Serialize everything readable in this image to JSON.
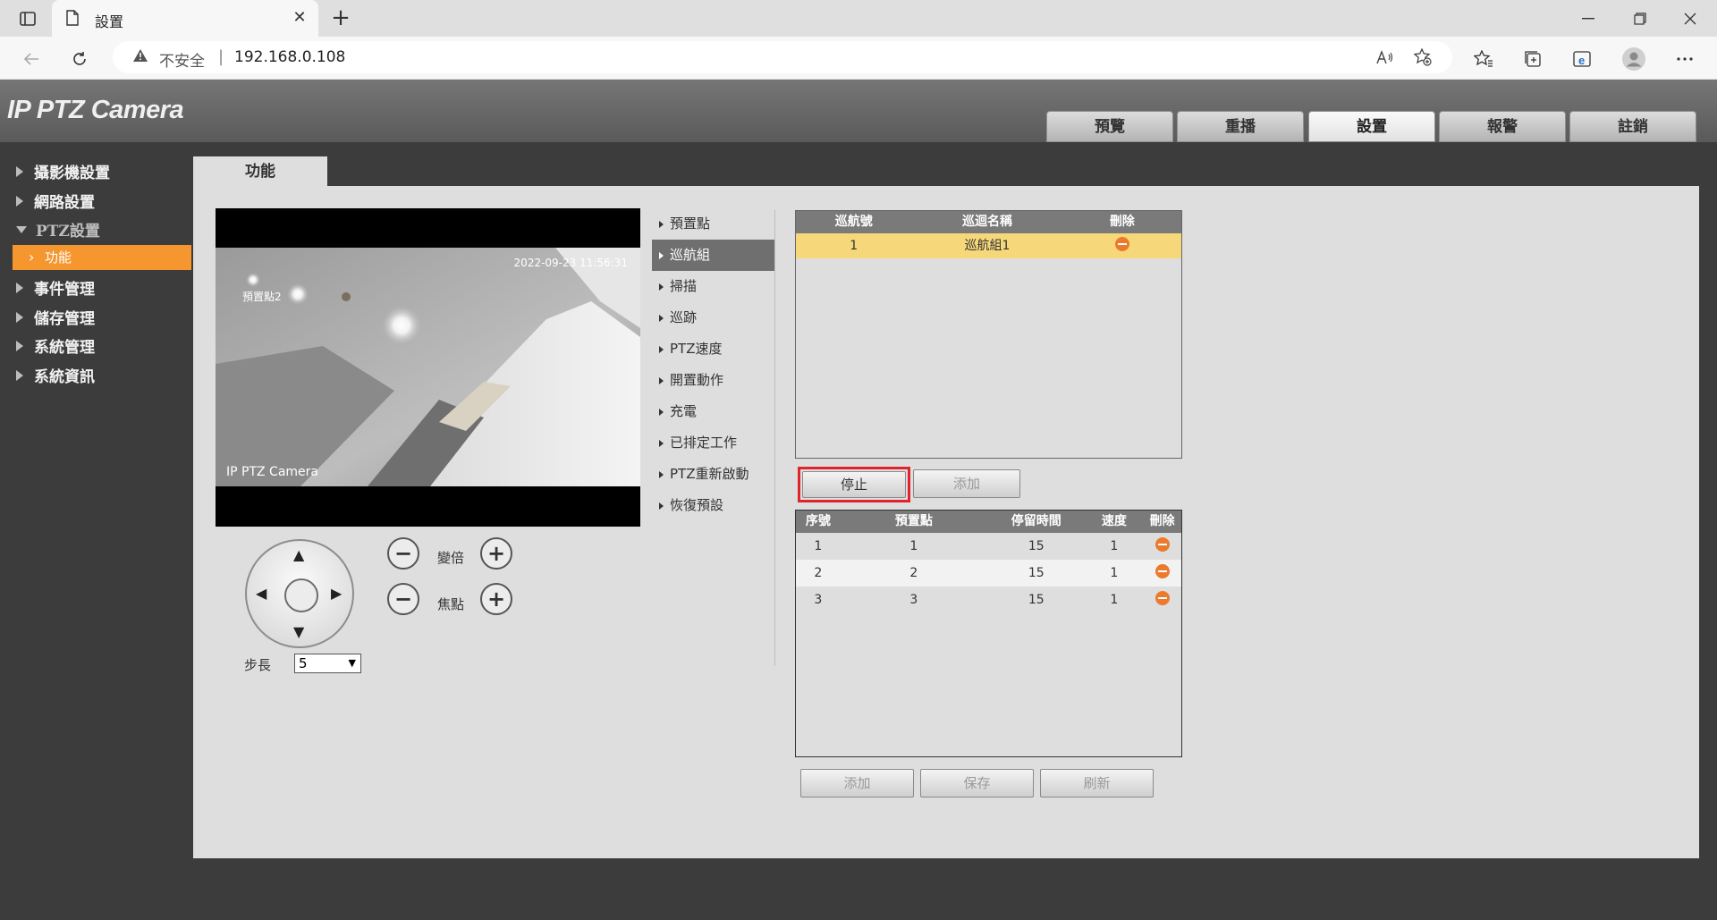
{
  "browser": {
    "tab_title": "設置",
    "tab_close": "✕",
    "new_tab": "+",
    "insecure_label": "不安全",
    "separator": "|",
    "url": "192.168.0.108"
  },
  "app": {
    "logo": "IP PTZ Camera",
    "main_tabs": [
      "預覽",
      "重播",
      "設置",
      "報警",
      "註銷"
    ],
    "active_main_tab": "設置"
  },
  "sidebar": {
    "items": [
      "攝影機設置",
      "網路設置",
      "PTZ設置",
      "事件管理",
      "儲存管理",
      "系統管理",
      "系統資訊"
    ],
    "open_item": "PTZ設置",
    "sub_item": "功能"
  },
  "content": {
    "tab_label": "功能"
  },
  "video": {
    "osd_time": "2022-09-23 11:56:31",
    "osd_preset": "預置點2",
    "osd_name": "IP PTZ Camera"
  },
  "ptz": {
    "zoom_label": "變倍",
    "focus_label": "焦點",
    "minus": "−",
    "plus": "+",
    "step_label": "步長",
    "step_value": "5",
    "arrow_up": "▲",
    "arrow_down": "▼",
    "arrow_left": "◀",
    "arrow_right": "▶"
  },
  "func_menu": {
    "items": [
      "預置點",
      "巡航組",
      "掃描",
      "巡跡",
      "PTZ速度",
      "開置動作",
      "充電",
      "已排定工作",
      "PTZ重新啟動",
      "恢復預設"
    ],
    "active": "巡航組"
  },
  "tour_table": {
    "headers": [
      "巡航號",
      "巡迴名稱",
      "刪除"
    ],
    "rows": [
      {
        "no": "1",
        "name": "巡航組1"
      }
    ]
  },
  "tour_buttons": {
    "stop": "停止",
    "add": "添加"
  },
  "point_table": {
    "headers": [
      "序號",
      "預置點",
      "停留時間",
      "速度",
      "刪除"
    ],
    "rows": [
      {
        "seq": "1",
        "preset": "1",
        "dwell": "15",
        "speed": "1"
      },
      {
        "seq": "2",
        "preset": "2",
        "dwell": "15",
        "speed": "1"
      },
      {
        "seq": "3",
        "preset": "3",
        "dwell": "15",
        "speed": "1"
      }
    ]
  },
  "bottom_buttons": {
    "add": "添加",
    "save": "保存",
    "refresh": "刷新"
  },
  "colors": {
    "active_sidebar": "#f5962f",
    "selected_row": "#f6d77a",
    "delete_icon": "#ec7a2d",
    "highlight_frame": "#e0242b"
  }
}
